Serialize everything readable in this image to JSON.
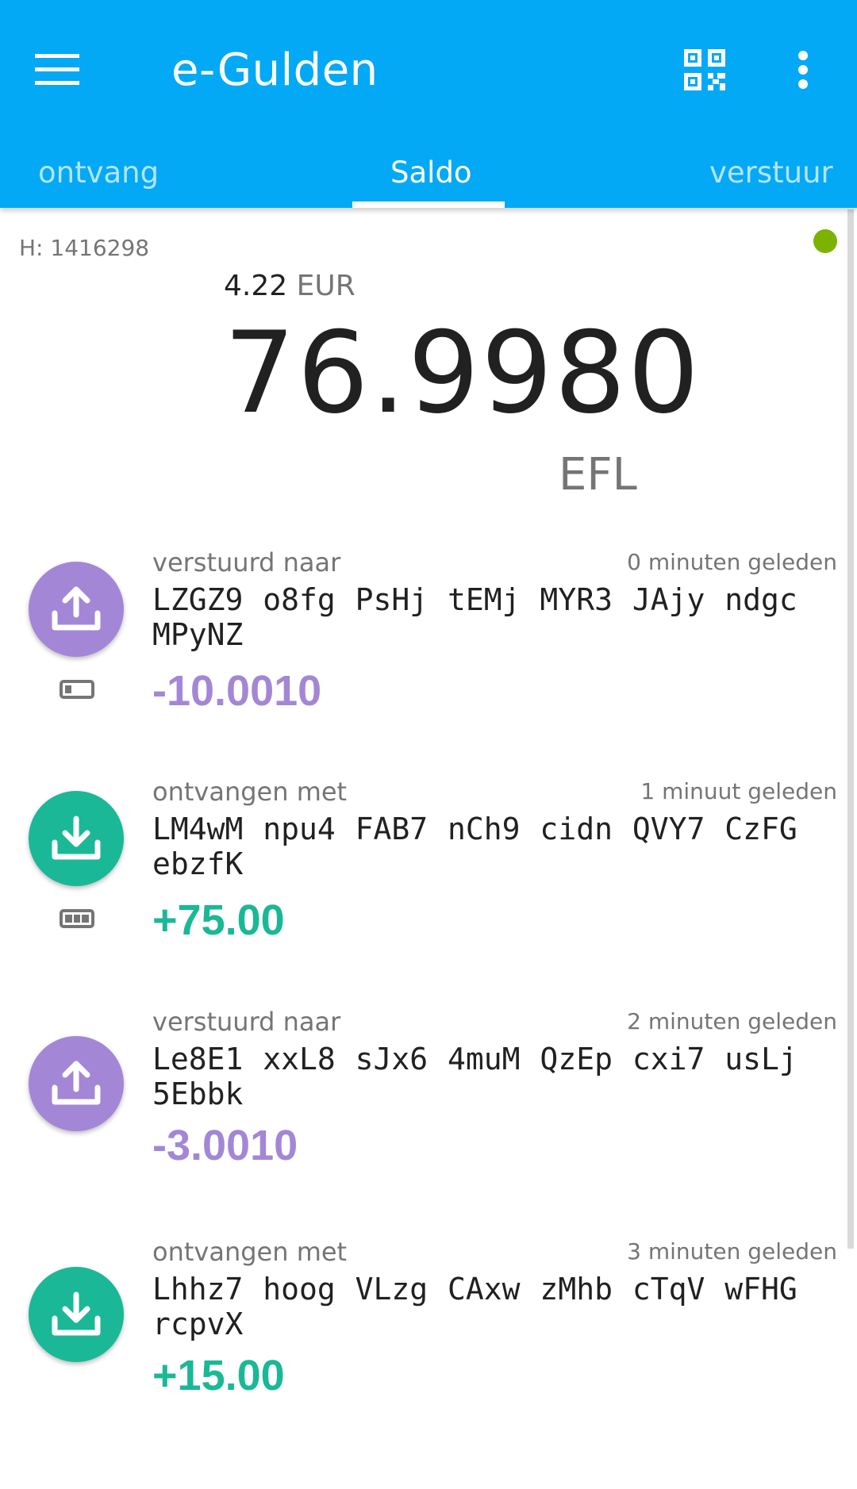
{
  "app": {
    "title": "e-Gulden",
    "menu_icon": "hamburger-menu-icon",
    "qr_icon": "qr-code-icon",
    "more_icon": "more-vert-icon",
    "accent_color": "#03a9f4"
  },
  "tabs": {
    "ontvang": "ontvang",
    "saldo": "Saldo",
    "verstuur": "verstuur",
    "active": "Saldo"
  },
  "status": {
    "block_height": "H: 1416298",
    "connection_color": "#7cb300"
  },
  "balance": {
    "fiat_amount": "4.22",
    "fiat_currency": "EUR",
    "amount": "76.9980",
    "unit": "EFL"
  },
  "transactions": [
    {
      "type": "sent",
      "label": "verstuurd naar",
      "time": "0 minuten geleden",
      "address": "LZGZ9 o8fg PsHj tEMj MYR3 JAjy ndgc MPyNZ",
      "amount": "-10.0010",
      "confirmation_icon": "battery-low-icon",
      "color": "#a387d6"
    },
    {
      "type": "received",
      "label": "ontvangen met",
      "time": "1 minuut geleden",
      "address": "LM4wM npu4 FAB7 nCh9 cidn QVY7 CzFG ebzfK",
      "amount": "+75.00",
      "confirmation_icon": "battery-full-icon",
      "color": "#1ab896"
    },
    {
      "type": "sent",
      "label": "verstuurd naar",
      "time": "2 minuten geleden",
      "address": "Le8E1 xxL8 sJx6 4muM QzEp cxi7 usLj 5Ebbk",
      "amount": "-3.0010",
      "color": "#a387d6"
    },
    {
      "type": "received",
      "label": "ontvangen met",
      "time": "3 minuten geleden",
      "address": "Lhhz7 hoog VLzg CAxw zMhb cTqV wFHG rcpvX",
      "amount": "+15.00",
      "color": "#1ab896"
    }
  ]
}
